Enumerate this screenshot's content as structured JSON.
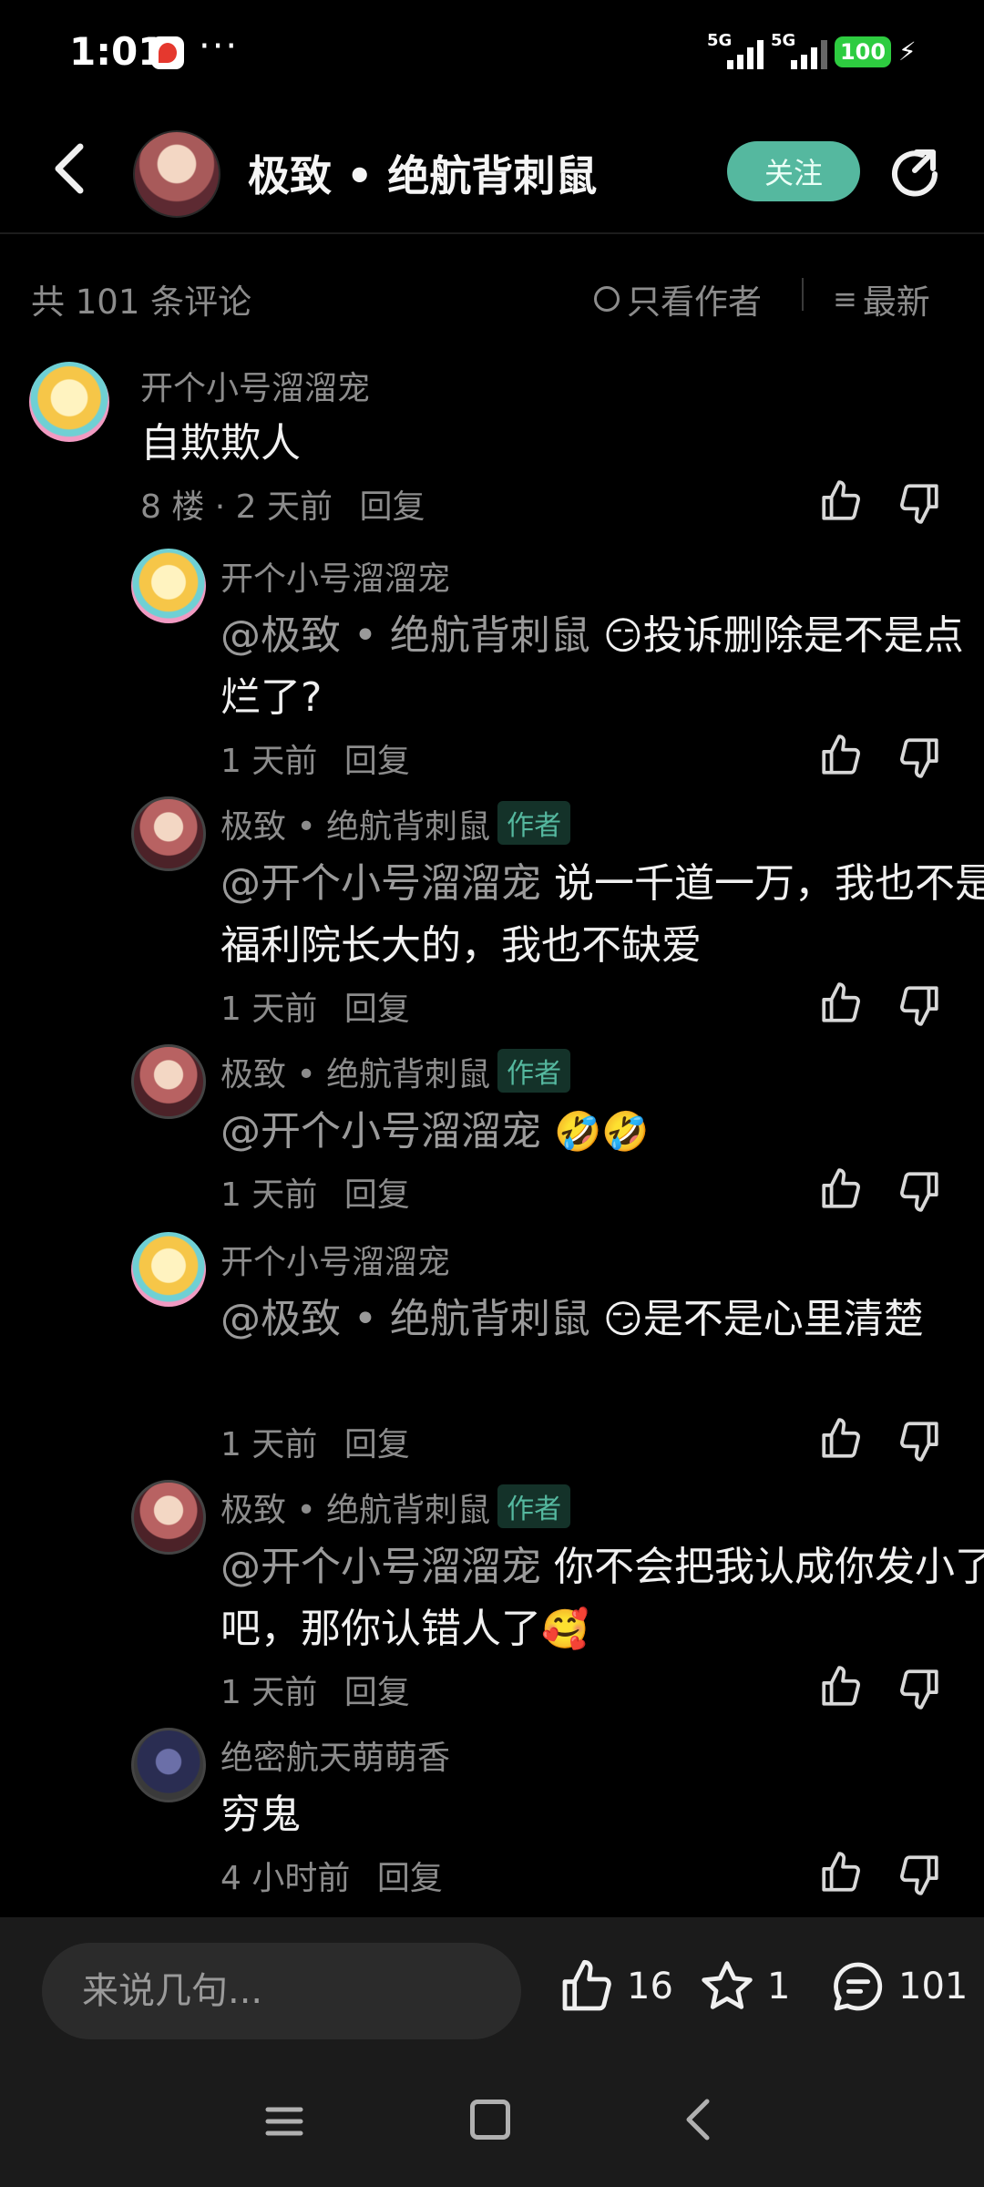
{
  "status_bar": {
    "time": "1:01",
    "more": "···",
    "signal_1": "5G",
    "signal_2": "5G",
    "battery": "100"
  },
  "header": {
    "title": "极致 • 绝航背刺鼠",
    "follow_label": "关注"
  },
  "toolbar": {
    "comment_count": "共 101 条评论",
    "author_only": "只看作者",
    "sort": "最新"
  },
  "comments": [
    {
      "name": "开个小号溜溜宠",
      "body": "自欺欺人",
      "meta": "8 楼 · 2 天前",
      "reply": "回复"
    },
    {
      "name": "开个小号溜溜宠",
      "mention": "@极致 • 绝航背刺鼠",
      "emoji": "😏",
      "body": "投诉删除是不是点烂了?",
      "time": "1 天前",
      "reply": "回复"
    },
    {
      "name": "极致 • 绝航背刺鼠",
      "badge": "作者",
      "mention": "@开个小号溜溜宠",
      "body": "说一千道一万，我也不是福利院长大的，我也不缺爱",
      "time": "1 天前",
      "reply": "回复"
    },
    {
      "name": "极致 • 绝航背刺鼠",
      "badge": "作者",
      "mention": "@开个小号溜溜宠",
      "emoji": "🤣🤣",
      "time": "1 天前",
      "reply": "回复"
    },
    {
      "name": "开个小号溜溜宠",
      "mention": "@极致 • 绝航背刺鼠",
      "emoji": "😏",
      "body": "是不是心里清楚",
      "time": "1 天前",
      "reply": "回复"
    },
    {
      "name": "极致 • 绝航背刺鼠",
      "badge": "作者",
      "mention": "@开个小号溜溜宠",
      "body": "你不会把我认成你发小了吧，那你认错人了",
      "emoji": "🥰",
      "time": "1 天前",
      "reply": "回复"
    },
    {
      "name": "绝密航天萌萌香",
      "body": "穷鬼",
      "time": "4 小时前",
      "reply": "回复"
    }
  ],
  "bottom_bar": {
    "input_placeholder": "来说几句...",
    "like_count": "16",
    "star_count": "1",
    "comment_count": "101"
  },
  "colors": {
    "background": "#000000",
    "accent": "#55b89f",
    "muted_text": "#8c8c8c"
  }
}
